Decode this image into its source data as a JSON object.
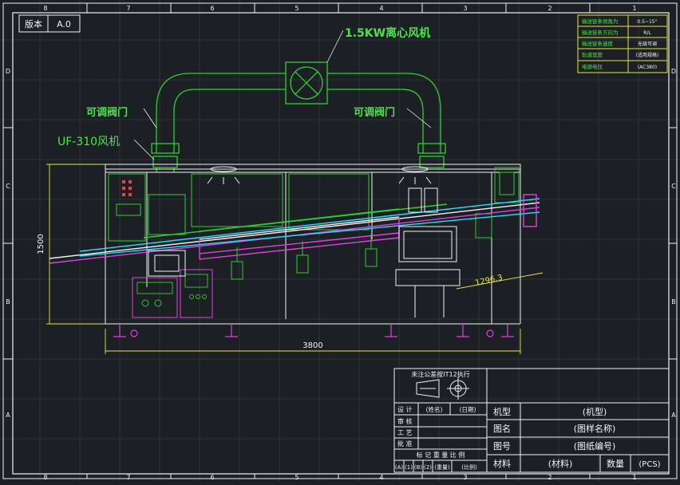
{
  "version": {
    "label": "版本",
    "value": "A.0"
  },
  "border": {
    "top_cols": [
      "8",
      "7",
      "6",
      "5",
      "4",
      "3",
      "2",
      "1"
    ],
    "bottom_cols": [
      "8",
      "7",
      "6",
      "5",
      "4",
      "3",
      "2",
      "1"
    ],
    "rows_right": [
      "D",
      "C",
      "B",
      "A"
    ],
    "rows_left": [
      "D",
      "C",
      "B",
      "A"
    ]
  },
  "notes": [
    {
      "label": "输送链条倾角为",
      "value": "0.5~15°"
    },
    {
      "label": "输送链条方向为",
      "value": "R/L"
    },
    {
      "label": "输送链条速度",
      "value": "无级可调"
    },
    {
      "label": "轨道宽度",
      "value": "(适用规格)"
    },
    {
      "label": "电源电压",
      "value": "(AC380)"
    }
  ],
  "callouts": {
    "blower": "1.5KW离心风机",
    "valve_left": "可调阀门",
    "valve_right": "可调阀门",
    "uf_fan": "UF-310风机"
  },
  "dimensions": {
    "height": "1500",
    "length": "3800",
    "incline": "1296.3"
  },
  "title_block": {
    "tolerance_note": "未注公差按IT12执行",
    "rows": [
      {
        "label": "设 计",
        "name": "(姓名)",
        "date": "(日期)"
      },
      {
        "label": "审 核"
      },
      {
        "label": "工 艺"
      },
      {
        "label": "批 准"
      }
    ],
    "header_row": "标 记 重 量 比 例",
    "bottom_row": [
      "(A)",
      "(1)",
      "(B)",
      "(2)",
      "(重量)",
      "(比例)"
    ],
    "fields": [
      {
        "label": "机型",
        "value": "(机型)"
      },
      {
        "label": "图名",
        "value": "(图样名称)"
      },
      {
        "label": "图号",
        "value": "(图纸编号)"
      },
      {
        "label": "材料",
        "value": "(材料)",
        "extra_label": "数量",
        "extra_value": "(PCS)"
      }
    ]
  },
  "colors": {
    "background": "#1c2025",
    "frame": "#f2f2f2",
    "text_green": "#4ee24e",
    "machine_green": "#33cc33",
    "conveyor_cyan": "#22e0ff",
    "magenta": "#e040e0",
    "dimension_yellow": "#e6e642",
    "red": "#ff3a3a"
  }
}
